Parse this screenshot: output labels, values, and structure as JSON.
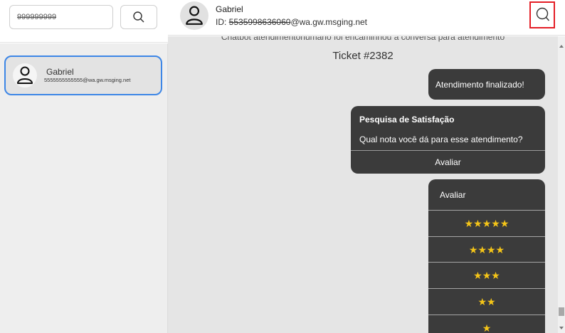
{
  "sidebar": {
    "search": {
      "value": "999999999",
      "icon": "search-icon"
    },
    "contacts": [
      {
        "name": "Gabriel",
        "subtitle": "5555555555555@wa.gw.msging.net",
        "icon": "user-icon"
      }
    ]
  },
  "header": {
    "name": "Gabriel",
    "id_prefix": "ID: ",
    "id_number": "5535998636060",
    "id_domain": "@wa.gw.msging.net",
    "icon": "user-icon",
    "search_icon": "search-icon"
  },
  "chat": {
    "system_message": "Chatbot atendimentohumano foi encaminhou a conversa para atendimento",
    "ticket": "Ticket #2382",
    "messages": {
      "finished": "Atendimento finalizado!",
      "survey_title": "Pesquisa de Satisfação",
      "survey_question": "Qual nota você dá para esse atendimento?",
      "survey_button": "Avaliar",
      "rating_title": "Avaliar"
    },
    "rating_options": [
      "★★★★★",
      "★★★★",
      "★★★",
      "★★",
      "★"
    ]
  },
  "colors": {
    "accent_border": "#3d86e6",
    "highlight_red": "#e41e26",
    "bubble_bg": "#3b3b3b",
    "star": "#f5c518"
  }
}
